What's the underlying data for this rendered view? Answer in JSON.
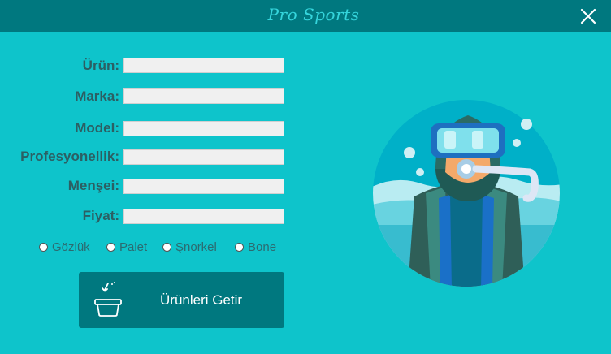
{
  "window": {
    "title": "Pro Sports"
  },
  "form": {
    "fields": [
      {
        "label": "Ürün:",
        "value": ""
      },
      {
        "label": "Marka:",
        "value": ""
      },
      {
        "label": "Model:",
        "value": ""
      },
      {
        "label": "Profesyonellik:",
        "value": ""
      },
      {
        "label": "Menşei:",
        "value": ""
      },
      {
        "label": "Fiyat:",
        "value": ""
      }
    ],
    "options": [
      {
        "label": "Gözlük",
        "selected": false
      },
      {
        "label": "Palet",
        "selected": false
      },
      {
        "label": "Şnorkel",
        "selected": false
      },
      {
        "label": "Bone",
        "selected": false
      }
    ],
    "submit_label": "Ürünleri Getir"
  },
  "icons": {
    "close": "close-icon",
    "button": "basket-arrow-icon",
    "illustration": "scuba-diver-illustration"
  },
  "colors": {
    "background": "#0ec4cb",
    "titlebar": "#00787f",
    "title_text": "#35d5dc",
    "button": "#00787f",
    "label_text": "#2c5f63"
  }
}
